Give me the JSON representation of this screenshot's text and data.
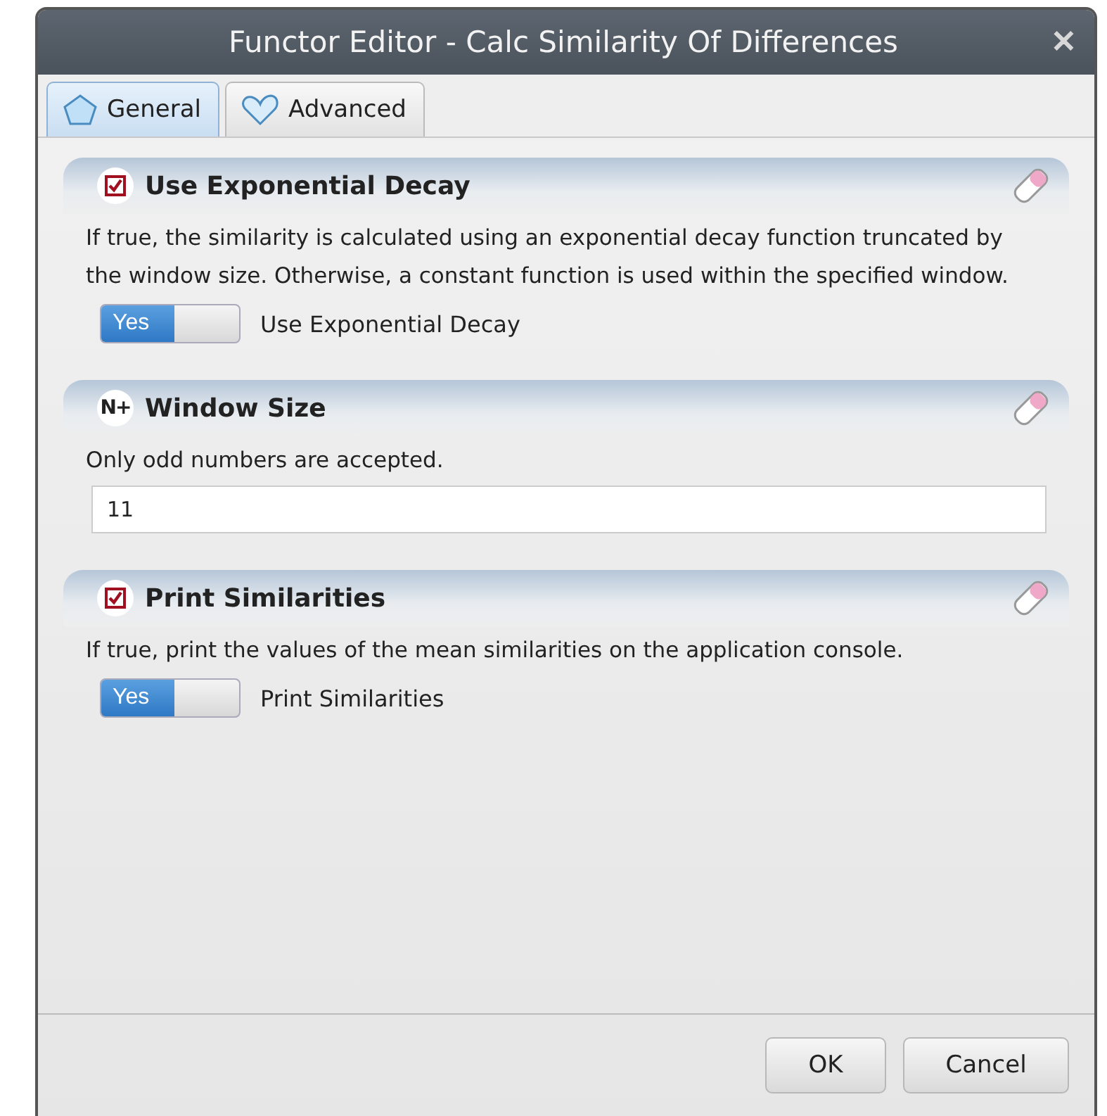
{
  "window": {
    "title": "Functor Editor - Calc Similarity Of Differences",
    "close": "✕"
  },
  "tabs": [
    {
      "label": "General",
      "selected": true
    },
    {
      "label": "Advanced",
      "selected": false
    }
  ],
  "sections": [
    {
      "kind": "boolean",
      "title": "Use Exponential Decay",
      "description": "If true, the similarity is calculated using an exponential decay function truncated by the window size. Otherwise, a constant function is used within the specified window.",
      "toggle": {
        "on": true,
        "label": "Yes"
      },
      "toggle_caption": "Use Exponential Decay"
    },
    {
      "kind": "number",
      "glyph": "N+",
      "title": "Window Size",
      "description": "Only odd numbers are accepted.",
      "value": "11"
    },
    {
      "kind": "boolean",
      "title": "Print Similarities",
      "description": "If true, print the values of the mean similarities on the application console.",
      "toggle": {
        "on": true,
        "label": "Yes"
      },
      "toggle_caption": "Print Similarities"
    }
  ],
  "buttons": [
    "OK",
    "Cancel"
  ]
}
